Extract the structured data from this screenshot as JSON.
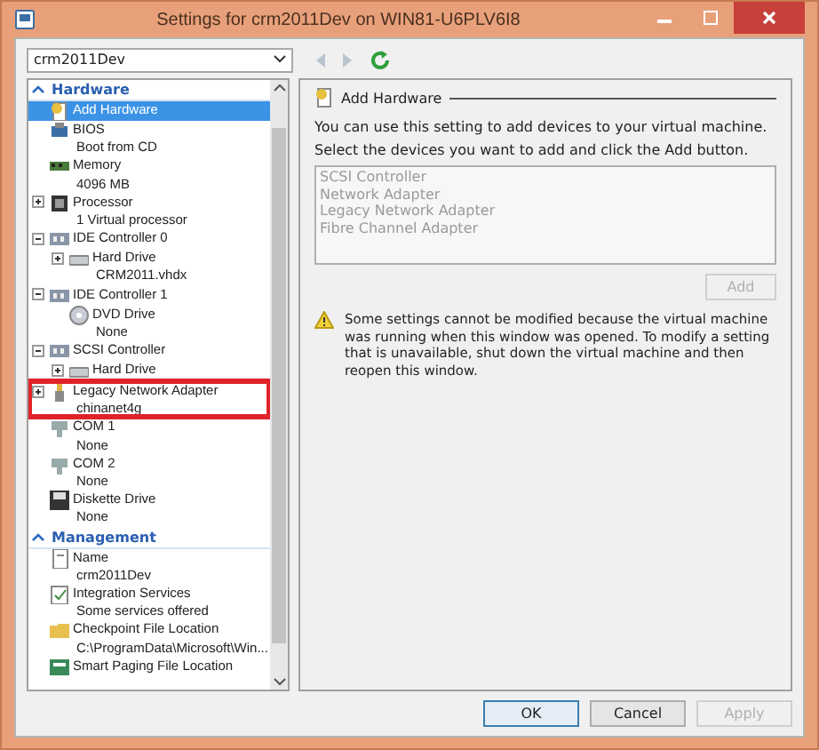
{
  "window": {
    "title": "Settings for crm2011Dev on WIN81-U6PLV6I8"
  },
  "vm_selector": {
    "value": "crm2011Dev"
  },
  "toolbar": [
    {
      "kind": "back",
      "disabled": true
    },
    {
      "kind": "forward",
      "disabled": true
    },
    {
      "kind": "refresh",
      "disabled": false
    }
  ],
  "sidebar": {
    "sections": [
      {
        "title": "Hardware",
        "items": [
          {
            "kind": "add",
            "label": "Add Hardware",
            "selected": true,
            "highlighted": false
          },
          {
            "kind": "chip",
            "label": "BIOS",
            "sub": "Boot from CD",
            "selected": false,
            "highlighted": false
          },
          {
            "kind": "memory",
            "label": "Memory",
            "sub": "4096 MB",
            "selected": false,
            "highlighted": false
          },
          {
            "kind": "processor",
            "label": "Processor",
            "sub": "1 Virtual processor",
            "selected": false,
            "highlighted": false,
            "expanded": false
          },
          {
            "kind": "controller",
            "label": "IDE Controller 0",
            "selected": false,
            "highlighted": false,
            "expanded": true,
            "children": [
              {
                "kind": "disk",
                "label": "Hard Drive",
                "sub": "CRM2011.vhdx",
                "selected": false,
                "highlighted": false,
                "expanded": false
              }
            ]
          },
          {
            "kind": "controller",
            "label": "IDE Controller 1",
            "selected": false,
            "highlighted": false,
            "expanded": true,
            "children": [
              {
                "kind": "dvd",
                "label": "DVD Drive",
                "sub": "None",
                "selected": false,
                "highlighted": false
              }
            ]
          },
          {
            "kind": "controller",
            "label": "SCSI Controller",
            "selected": false,
            "highlighted": false,
            "expanded": true,
            "children": [
              {
                "kind": "disk",
                "label": "Hard Drive",
                "selected": false,
                "highlighted": false,
                "expanded": false
              }
            ]
          },
          {
            "kind": "network",
            "label": "Legacy Network Adapter",
            "sub": "chinanet4g",
            "selected": false,
            "highlighted": true,
            "expanded": false
          },
          {
            "kind": "port",
            "label": "COM 1",
            "sub": "None",
            "selected": false,
            "highlighted": false
          },
          {
            "kind": "port",
            "label": "COM 2",
            "sub": "None",
            "selected": false,
            "highlighted": false
          },
          {
            "kind": "floppy",
            "label": "Diskette Drive",
            "sub": "None",
            "selected": false,
            "highlighted": false
          }
        ]
      },
      {
        "title": "Management",
        "items": [
          {
            "kind": "name",
            "label": "Name",
            "sub": "crm2011Dev",
            "selected": false,
            "highlighted": false
          },
          {
            "kind": "integration",
            "label": "Integration Services",
            "sub": "Some services offered",
            "selected": false,
            "highlighted": false
          },
          {
            "kind": "folder",
            "label": "Checkpoint File Location",
            "sub": "C:\\ProgramData\\Microsoft\\Win...",
            "selected": false,
            "highlighted": false
          },
          {
            "kind": "paging",
            "label": "Smart Paging File Location",
            "selected": false,
            "highlighted": false
          }
        ]
      }
    ]
  },
  "panel": {
    "title": "Add Hardware",
    "intro": "You can use this setting to add devices to your virtual machine.",
    "instruction": "Select the devices you want to add and click the Add button.",
    "devices": [
      {
        "label": "SCSI Controller",
        "disabled": true
      },
      {
        "label": "Network Adapter",
        "disabled": true
      },
      {
        "label": "Legacy Network Adapter",
        "disabled": true
      },
      {
        "label": "Fibre Channel Adapter",
        "disabled": true
      }
    ],
    "add_button": {
      "label": "Add",
      "disabled": true
    },
    "warning": "Some settings cannot be modified because the virtual machine was running when this window was opened. To modify a setting that is unavailable, shut down the virtual machine and then reopen this window."
  },
  "buttons": [
    {
      "label": "OK",
      "disabled": false,
      "default": true
    },
    {
      "label": "Cancel",
      "disabled": false,
      "default": false
    },
    {
      "label": "Apply",
      "disabled": true,
      "default": false
    }
  ]
}
